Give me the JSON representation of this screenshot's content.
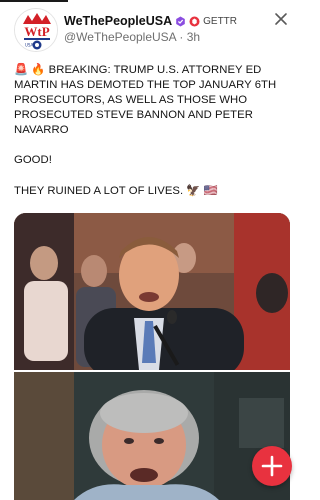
{
  "account": {
    "display_name": "WeThePeopleUSA",
    "platform": "GETTR",
    "handle": "@WeThePeopleUSA",
    "separator": "·",
    "time": "3h",
    "verified_badge_color": "#8a4de0",
    "platform_badge_color": "#e8323f"
  },
  "post": {
    "siren_emoji": "🚨",
    "fire_emoji": "🔥",
    "headline": "BREAKING: TRUMP U.S. ATTORNEY ED MARTIN HAS DEMOTED THE TOP JANUARY 6TH PROSECUTORS, AS WELL AS THOSE WHO PROSECUTED STEVE BANNON AND PETER NAVARRO",
    "line2": "GOOD!",
    "line3": "THEY RUINED A LOT OF LIVES.",
    "eagle_emoji": "🦅",
    "flag_emoji": "🇺🇸"
  },
  "icons": {
    "close": "close-icon",
    "add": "plus-icon",
    "verified": "verified-badge-icon",
    "platform": "gettr-badge-icon"
  },
  "colors": {
    "accent": "#e8323f",
    "text": "#141414",
    "muted": "#6f6f6f"
  }
}
